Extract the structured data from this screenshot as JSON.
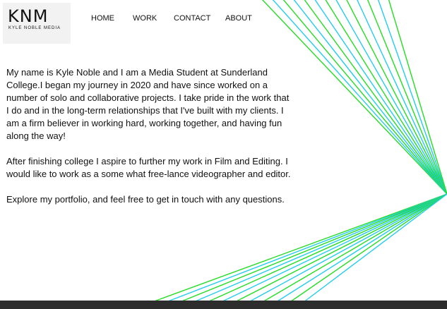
{
  "logo": {
    "mark": "KNM",
    "subtitle": "KYLE NOBLE MEDIA"
  },
  "nav": {
    "home": "HOME",
    "work": "WORK",
    "contact": "CONTACT",
    "about": "ABOUT"
  },
  "bio": {
    "paragraph_1": "My name is Kyle Noble and I am a Media Student at Sunderland College.I began my journey in 2020 and have since worked on a number of solo and collaborative projects. I take pride in the work that I do and in the long-term relationships that I've built with my clients. I am a firm believer in working hard, working together, and having fun along the way!",
    "paragraph_2": "After finishing college I aspire to further my work in Film and Editing. I would like to work as a some what free-lance videographer and editor.",
    "paragraph_3": "Explore my portfolio, and feel free to get in touch with any questions."
  },
  "colors": {
    "line_green": "#22dd22",
    "line_cyan": "#22ccee",
    "footer": "#2d2d2d",
    "text": "#111111"
  }
}
